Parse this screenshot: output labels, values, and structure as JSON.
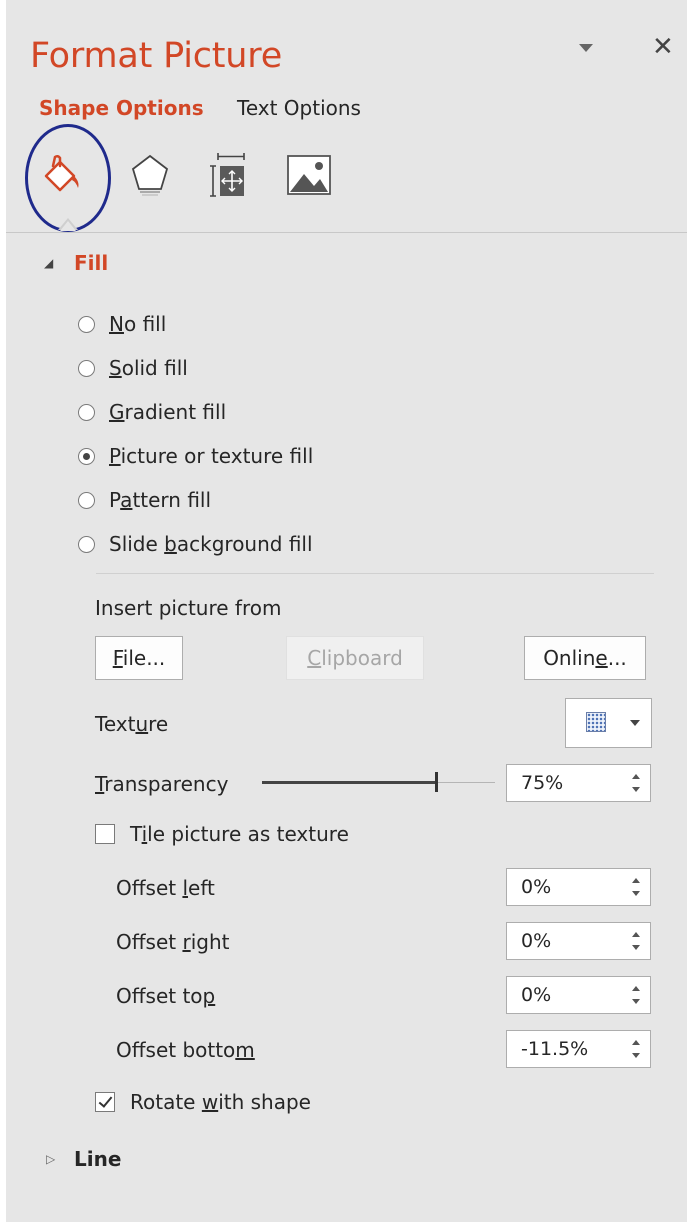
{
  "pane": {
    "title": "Format Picture",
    "close_glyph": "✕"
  },
  "tabs": {
    "shape_options": "Shape Options",
    "text_options": "Text Options"
  },
  "icon_row": {
    "icons": [
      "fill-line-icon",
      "effects-icon",
      "size-properties-icon",
      "picture-icon"
    ],
    "selected": "fill-line-icon",
    "highlight_ring_color": "#1f2a8c"
  },
  "colors": {
    "accent": "#d24726",
    "pane_background": "#e6e6e6"
  },
  "fill": {
    "header": "Fill",
    "options": {
      "no_fill": {
        "key": "N",
        "rest": "o fill"
      },
      "solid_fill": {
        "key": "S",
        "rest": "olid fill"
      },
      "gradient_fill": {
        "key": "G",
        "rest": "radient fill"
      },
      "picture_fill": {
        "key": "P",
        "rest": "icture or texture fill",
        "checked": true
      },
      "pattern_fill": {
        "pre": "P",
        "key": "a",
        "rest": "ttern fill"
      },
      "slide_background_fill": {
        "pre": "Slide ",
        "key": "b",
        "rest": "ackground fill"
      }
    },
    "insert_picture_from": "Insert picture from",
    "buttons": {
      "file": {
        "key": "F",
        "rest": "ile..."
      },
      "clipboard": {
        "key": "C",
        "rest": "lipboard",
        "disabled": true
      },
      "online": {
        "pre": "Onlin",
        "key": "e",
        "rest": "..."
      }
    },
    "texture": {
      "pre": "Text",
      "key": "u",
      "rest": "re"
    },
    "transparency": {
      "key": "T",
      "rest": "ransparency",
      "value": "75%",
      "slider_fraction": 0.75
    },
    "tile": {
      "pre": "T",
      "key": "i",
      "rest": "le picture as texture",
      "checked": false
    },
    "offsets": {
      "left": {
        "pre": "Offset ",
        "key": "l",
        "rest": "eft",
        "value": "0%"
      },
      "right": {
        "pre": "Offset ",
        "key": "r",
        "rest": "ight",
        "value": "0%"
      },
      "top": {
        "pre": "Offset to",
        "key": "p",
        "rest": "",
        "value": "0%"
      },
      "bottom": {
        "pre": "Offset botto",
        "key": "m",
        "rest": "",
        "value": "-11.5%"
      }
    },
    "rotate": {
      "pre": "Rotate ",
      "key": "w",
      "rest": "ith shape",
      "checked": true
    }
  },
  "line": {
    "header": "Line"
  }
}
